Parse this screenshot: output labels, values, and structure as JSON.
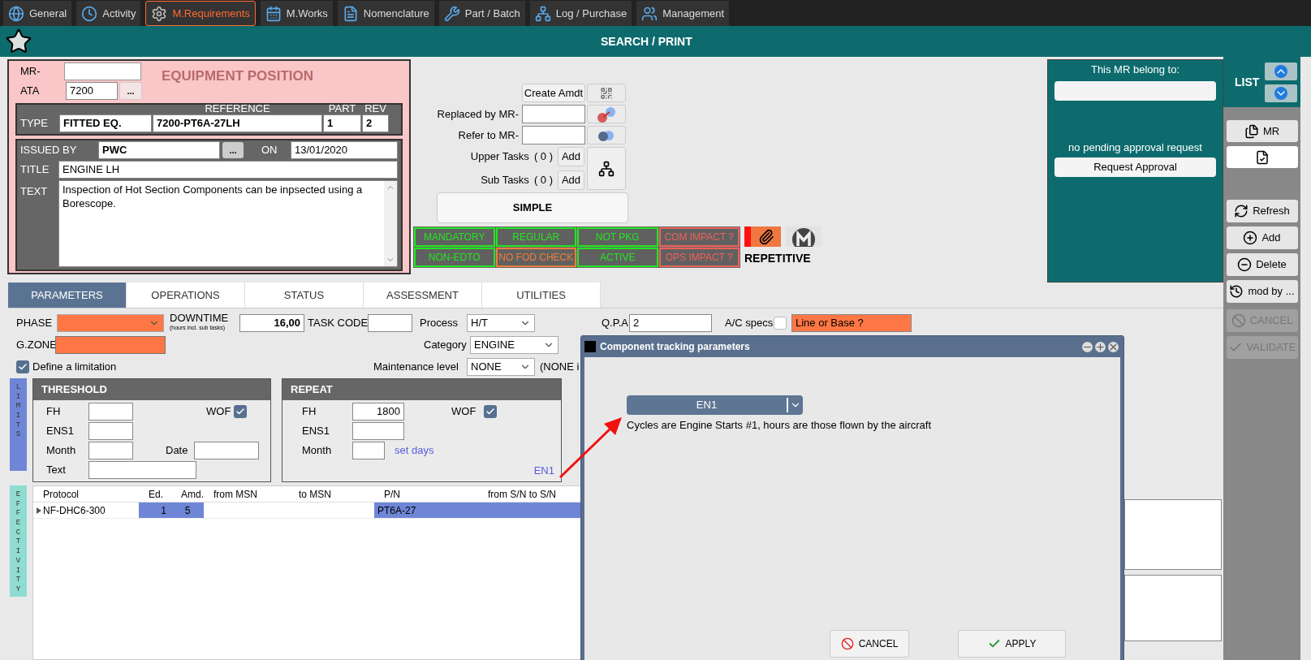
{
  "top_tabs": [
    {
      "label": "General",
      "kind": "globe",
      "selected": false
    },
    {
      "label": "Activity",
      "kind": "clock",
      "selected": false
    },
    {
      "label": "M.Requirements",
      "kind": "gear",
      "selected": true
    },
    {
      "label": "M.Works",
      "kind": "calendar",
      "selected": false
    },
    {
      "label": "Nomenclature",
      "kind": "doc",
      "selected": false
    },
    {
      "label": "Part / Batch",
      "kind": "tool",
      "selected": false
    },
    {
      "label": "Log / Purchase",
      "kind": "network",
      "selected": false
    },
    {
      "label": "Management",
      "kind": "org",
      "selected": false
    }
  ],
  "header": {
    "title": "SEARCH / PRINT"
  },
  "equipment": {
    "mr_label": "MR-",
    "ata_label": "ATA",
    "ata_value": "7200",
    "ata_button": "...",
    "heading": "EQUIPMENT POSITION",
    "type_label": "TYPE",
    "columns": [
      "REFERENCE",
      "PART",
      "REV"
    ],
    "type_value": "FITTED EQ.",
    "reference": "7200-PT6A-27LH",
    "part": "1",
    "rev": "2",
    "issued_by_label": "ISSUED BY",
    "issued_by": "PWC",
    "issued_button": "...",
    "on_label": "ON",
    "on_value": "13/01/2020",
    "title_label": "TITLE",
    "title_value": "ENGINE LH",
    "text_label": "TEXT",
    "text_value": "Inspection of Hot Section Components can be inpsected using a Borescope."
  },
  "links": {
    "create_amdt": "Create Amdt",
    "replaced_label": "Replaced by MR-",
    "refer_label": "Refer to MR-",
    "upper_label": "Upper Tasks",
    "upper_count": "( 0 )",
    "upper_add": "Add",
    "sub_label": "Sub Tasks",
    "sub_count": "( 0 )",
    "sub_add": "Add",
    "mode_button": "SIMPLE"
  },
  "flags": [
    {
      "label": "MANDATORY",
      "color": "#22e622"
    },
    {
      "label": "REGULAR",
      "color": "#22e622"
    },
    {
      "label": "NOT PKG",
      "color": "#22e622"
    },
    {
      "label": "COM IMPACT ?",
      "color": "#f0605a"
    },
    {
      "label": "NON-EDTO",
      "color": "#22e622"
    },
    {
      "label": "NO FOD CHECK",
      "color": "#f07c3c"
    },
    {
      "label": "ACTIVE",
      "color": "#22e622"
    },
    {
      "label": "OPS IMPACT ?",
      "color": "#f0605a"
    }
  ],
  "repetitive": "REPETITIVE",
  "belong": {
    "label": "This MR belong to:",
    "approval_status": "no pending approval request",
    "request_button": "Request Approval"
  },
  "sidebar": {
    "title": "LIST",
    "buttons": [
      {
        "kind": "mr",
        "label": "MR",
        "disabled": false
      },
      {
        "kind": "doc-check",
        "disabled": false
      },
      {
        "kind": "refresh",
        "label": "Refresh",
        "disabled": false
      },
      {
        "kind": "add",
        "label": "Add",
        "disabled": false
      },
      {
        "kind": "delete",
        "label": "Delete",
        "disabled": false
      },
      {
        "kind": "history",
        "label": "mod by ...",
        "disabled": false
      },
      {
        "kind": "cancel",
        "label": "CANCEL",
        "disabled": true
      },
      {
        "kind": "validate",
        "label": "VALIDATE",
        "disabled": true
      }
    ]
  },
  "section_tabs": [
    {
      "label": "PARAMETERS",
      "selected": true
    },
    {
      "label": "OPERATIONS",
      "selected": false
    },
    {
      "label": "STATUS",
      "selected": false
    },
    {
      "label": "ASSESSMENT",
      "selected": false
    },
    {
      "label": "UTILITIES",
      "selected": false
    }
  ],
  "params": {
    "phase_label": "PHASE",
    "downtime_label": "DOWNTIME",
    "downtime_hint": "(hours incl. sub tasks)",
    "downtime_value": "16,00",
    "task_code_label": "TASK CODE",
    "process_label": "Process",
    "process_value": "H/T",
    "qpa_label": "Q.P.A",
    "qpa_value": "2",
    "ac_specs_label": "A/C specs",
    "ac_specs_checked": false,
    "line_base": "Line or Base ?",
    "gzone_label": "G.ZONE",
    "category_label": "Category",
    "category_value": "ENGINE",
    "limitation_label": "Define a limitation",
    "limitation_checked": true,
    "maintenance_label": "Maintenance level",
    "maintenance_value": "NONE",
    "maintenance_note": "(NONE i"
  },
  "limits": {
    "side_label": "LIMITS",
    "threshold": {
      "title": "THRESHOLD",
      "fh_label": "FH",
      "ens_label": "ENS1",
      "month_label": "Month",
      "text_label": "Text",
      "date_label": "Date",
      "wof_label": "WOF",
      "wof_checked": true
    },
    "repeat": {
      "title": "REPEAT",
      "fh_label": "FH",
      "fh_value": "1800",
      "ens_label": "ENS1",
      "month_label": "Month",
      "set_days": "set days",
      "wof_label": "WOF",
      "wof_checked": true,
      "unit": "EN1"
    }
  },
  "effectivity": {
    "side_label": "EFFECTIVITY",
    "columns": [
      "Protocol",
      "Ed.",
      "Amd.",
      "from MSN",
      "to MSN",
      "P/N",
      "from S/N to S/N"
    ],
    "rows": [
      {
        "protocol": "NF-DHC6-300",
        "ed": "1",
        "amd": "5",
        "pn": "PT6A-27"
      }
    ]
  },
  "dialog": {
    "title": "Component tracking parameters",
    "dropdown_value": "EN1",
    "description": "Cycles are Engine Starts #1, hours are those flown by the aircraft",
    "cancel": "CANCEL",
    "apply": "APPLY"
  }
}
